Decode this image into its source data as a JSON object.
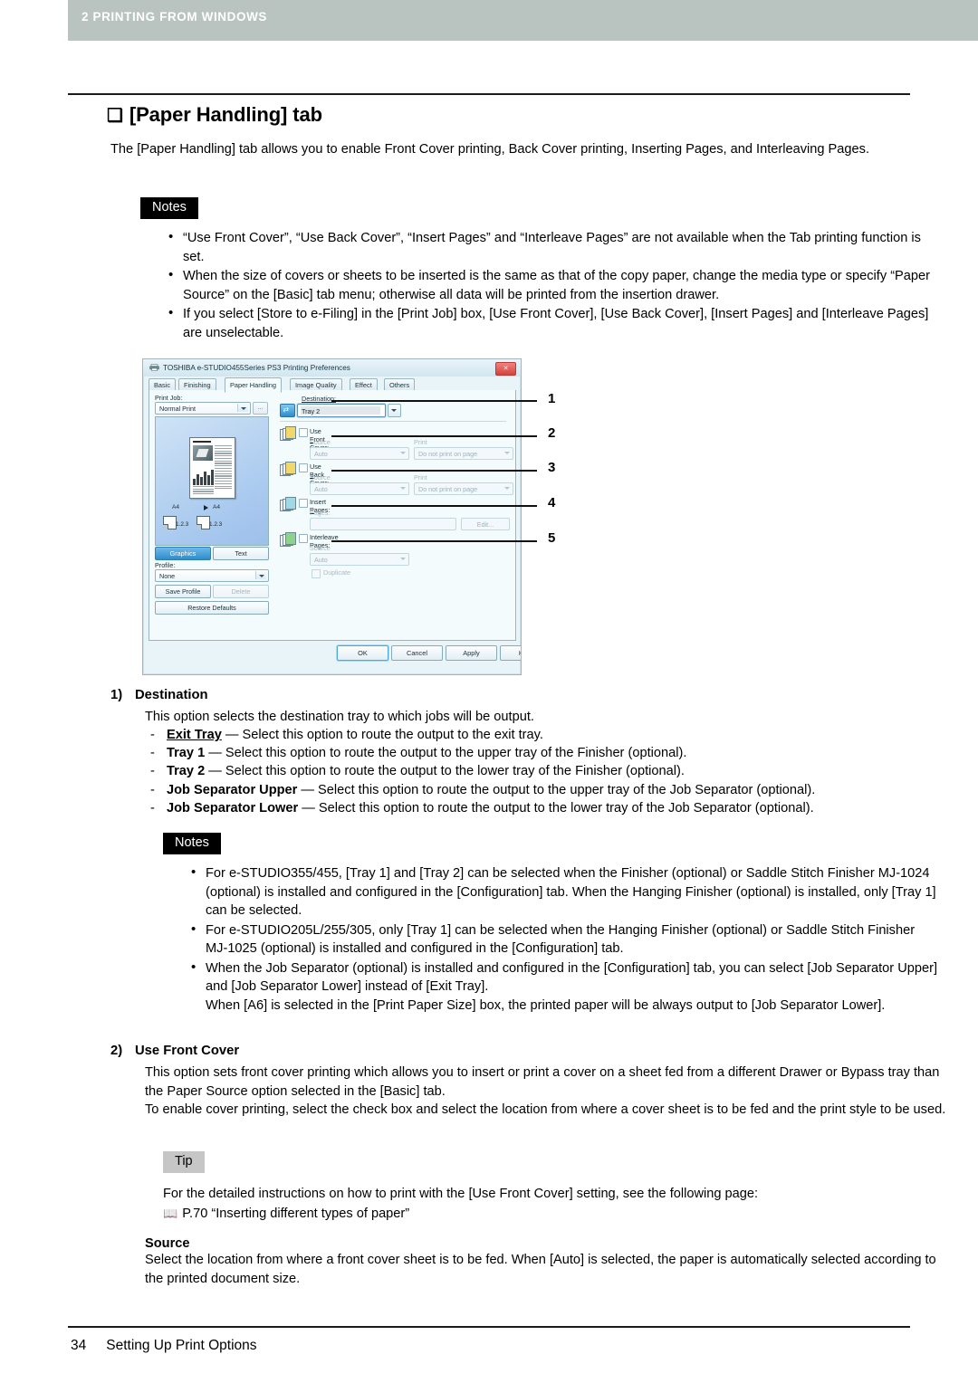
{
  "header": {
    "chapter": "2 PRINTING FROM WINDOWS",
    "band_color": "#b9c4c0"
  },
  "section": {
    "bullet_glyph": "❑",
    "title": "[Paper Handling] tab",
    "intro": "The [Paper Handling] tab allows you to enable Front Cover printing, Back Cover printing, Inserting Pages, and Interleaving Pages."
  },
  "notes1": {
    "label": "Notes",
    "items": [
      "“Use Front Cover”, “Use Back Cover”, “Insert Pages” and “Interleave Pages” are not available when the Tab printing function is set.",
      "When the size of covers or sheets to be inserted is the same as that of the copy paper, change the media type or specify “Paper Source” on the [Basic] tab menu; otherwise all data will be printed from the insertion drawer.",
      "If you select [Store to e-Filing] in the [Print Job] box, [Use Front Cover], [Use Back Cover], [Insert Pages] and [Interleave Pages] are unselectable."
    ]
  },
  "dialog": {
    "title": "TOSHIBA e-STUDIO455Series PS3 Printing Preferences",
    "close_label": "✕",
    "tabs": [
      {
        "label": "Basic",
        "active": false
      },
      {
        "label": "Finishing",
        "active": false
      },
      {
        "label": "Paper Handling",
        "active": true
      },
      {
        "label": "Image Quality",
        "active": false
      },
      {
        "label": "Effect",
        "active": false
      },
      {
        "label": "Others",
        "active": false
      }
    ],
    "left": {
      "print_job_label": "Print Job:",
      "print_job_value": "Normal Print",
      "browse_label": "...",
      "preview_size_left": "A4",
      "preview_size_right": "A4",
      "preview_order_left": "1.2.3",
      "preview_order_right": "1.2.3",
      "toggle_graphics": "Graphics",
      "toggle_text": "Text",
      "profile_label": "Profile:",
      "profile_value": "None",
      "save_profile": "Save Profile",
      "delete_profile": "Delete",
      "restore_defaults": "Restore Defaults"
    },
    "right": {
      "destination_label": "Destination:",
      "destination_value": "Tray 2",
      "front_cover_label": "Use Front Cover:",
      "front_cover_source_label": "Source",
      "front_cover_source_value": "Auto",
      "front_cover_style_label": "Print Style",
      "front_cover_style_value": "Do not print on page",
      "back_cover_label": "Use Back Cover:",
      "back_cover_source_label": "Source",
      "back_cover_source_value": "Auto",
      "back_cover_style_label": "Print Style",
      "back_cover_style_value": "Do not print on page",
      "insert_pages_label": "Insert Pages:",
      "insert_pages_sub_label": "Pages:",
      "insert_pages_value": "",
      "insert_edit_button": "Edit...",
      "interleave_label": "Interleave Pages:",
      "interleave_source_label": "Source",
      "interleave_source_value": "Auto",
      "duplicate_label": "Duplicate"
    },
    "footer_buttons": [
      "OK",
      "Cancel",
      "Apply",
      "Help"
    ]
  },
  "callouts": [
    "1",
    "2",
    "3",
    "4",
    "5"
  ],
  "option1": {
    "number": "1)",
    "name": "Destination",
    "intro": "This option selects the destination tray to which jobs will be output.",
    "choices": [
      {
        "term": "Exit Tray",
        "underline": true,
        "desc": " — Select this option to route the output to the exit tray."
      },
      {
        "term": "Tray 1",
        "underline": false,
        "desc": " — Select this option to route the output to the upper tray of the Finisher (optional)."
      },
      {
        "term": "Tray 2",
        "underline": false,
        "desc": " — Select this option to route the output to the lower tray of the Finisher (optional)."
      },
      {
        "term": "Job Separator Upper",
        "underline": false,
        "desc": " — Select this option to route the output to the upper tray of the Job Separator (optional)."
      },
      {
        "term": "Job Separator Lower",
        "underline": false,
        "desc": " — Select this option to route the output to the lower tray of the Job Separator (optional)."
      }
    ]
  },
  "notes2": {
    "label": "Notes",
    "items": [
      "For e-STUDIO355/455, [Tray 1] and [Tray 2] can be selected when the Finisher (optional) or Saddle Stitch Finisher MJ-1024 (optional) is installed and configured in the [Configuration] tab. When the Hanging Finisher (optional) is installed, only [Tray 1] can be selected.",
      "For e-STUDIO205L/255/305, only [Tray 1] can be selected when the Hanging Finisher (optional) or Saddle Stitch Finisher MJ-1025 (optional) is installed and configured in the [Configuration] tab.",
      "When the Job Separator (optional) is installed and configured in the [Configuration] tab, you can select [Job Separator Upper] and [Job Separator Lower] instead of [Exit Tray].\nWhen [A6] is selected in the [Print Paper Size] box, the printed paper will be always output to [Job Separator Lower]."
    ]
  },
  "option2": {
    "number": "2)",
    "name": "Use Front Cover",
    "para1": "This option sets front cover printing which allows you to insert or print a cover on a sheet fed from a different Drawer or Bypass tray than the Paper Source option selected in the [Basic] tab.",
    "para2": "To enable cover printing, select the check box and select the location from where a cover sheet is to be fed and the print style to be used."
  },
  "tip": {
    "label": "Tip",
    "line1": "For the detailed instructions on how to print with the [Use Front Cover] setting, see the following page:",
    "book_icon": "📖",
    "line2": "P.70 “Inserting different types of paper”"
  },
  "source_block": {
    "heading": "Source",
    "text": "Select the location from where a front cover sheet is to be fed. When [Auto] is selected, the paper is automatically selected according to the printed document size."
  },
  "footer": {
    "page_number": "34",
    "title": "Setting Up Print Options"
  }
}
